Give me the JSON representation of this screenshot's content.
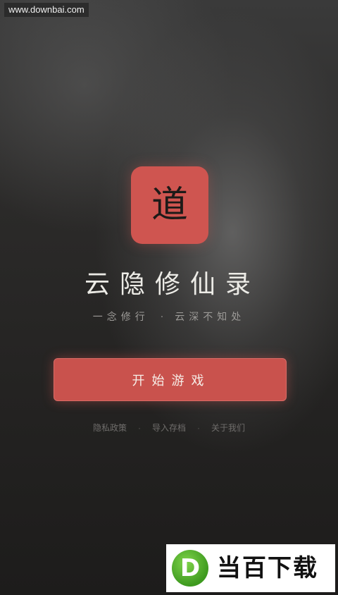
{
  "watermark": {
    "url": "www.downbai.com"
  },
  "logo": {
    "char": "道",
    "color": "#cf5550"
  },
  "app": {
    "title": "云隐修仙录",
    "tagline_left": "一念修行",
    "tagline_separator": "·",
    "tagline_right": "云深不知处"
  },
  "actions": {
    "start_label": "开始游戏",
    "accent_color": "#c9524d"
  },
  "footer": {
    "links": [
      "隐私政策",
      "导入存档",
      "关于我们"
    ],
    "separator": "·"
  },
  "brand": {
    "badge_letter": "D",
    "text": "当百下载",
    "badge_color": "#4caf28"
  }
}
